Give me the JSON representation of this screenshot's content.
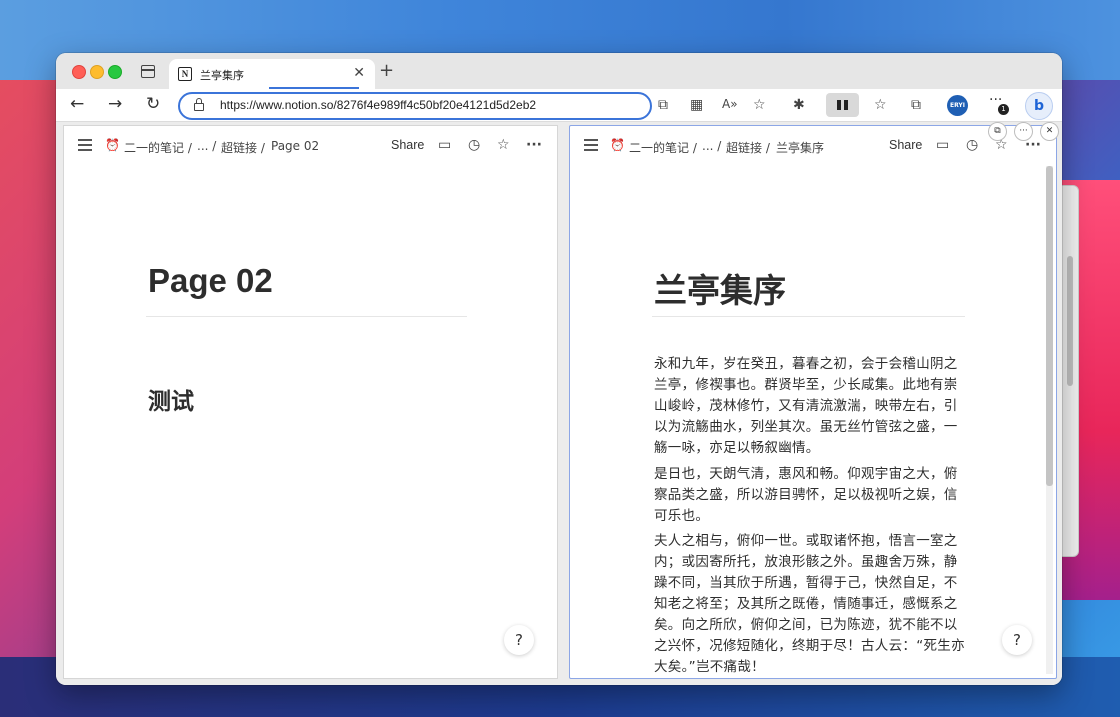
{
  "browser": {
    "tab": {
      "favicon": "N",
      "title": "兰亭集序"
    },
    "url": "https://www.notion.so/8276f4e989ff4c50bf20e4121d5d2eb2",
    "avatar": "ERYI",
    "notification_count": "1",
    "bing_label": "b"
  },
  "left_pane": {
    "breadcrumb": [
      "二一的笔记",
      "...",
      "超链接",
      "Page 02"
    ],
    "share_label": "Share",
    "title": "Page 02",
    "heading": "测试",
    "help_label": "?"
  },
  "right_pane": {
    "breadcrumb": [
      "二一的笔记",
      "...",
      "超链接",
      "兰亭集序"
    ],
    "share_label": "Share",
    "title": "兰亭集序",
    "paragraphs": [
      [
        "永和九年，岁在癸丑，暮春之初，会于会稽山阴之",
        "兰亭，修禊事也。群贤毕至，少长咸集。此地有崇",
        "山峻岭，茂林修竹，又有清流激湍，映带左右，引",
        "以为流觞曲水，列坐其次。虽无丝竹管弦之盛，一",
        "觞一咏，亦足以畅叙幽情。"
      ],
      [
        "是日也，天朗气清，惠风和畅。仰观宇宙之大，俯",
        "察品类之盛，所以游目骋怀，足以极视听之娱，信",
        "可乐也。"
      ],
      [
        "夫人之相与，俯仰一世。或取诸怀抱，悟言一室之",
        "内；或因寄所托，放浪形骸之外。虽趣舍万殊，静",
        "躁不同，当其欣于所遇，暂得于己，快然自足，不",
        "知老之将至；及其所之既倦，情随事迁，感慨系之",
        "矣。向之所欣，俯仰之间，已为陈迹，犹不能不以",
        "之兴怀，况修短随化，终期于尽！古人云：“死生亦",
        "大矣。”岂不痛哉！"
      ]
    ],
    "help_label": "?"
  }
}
